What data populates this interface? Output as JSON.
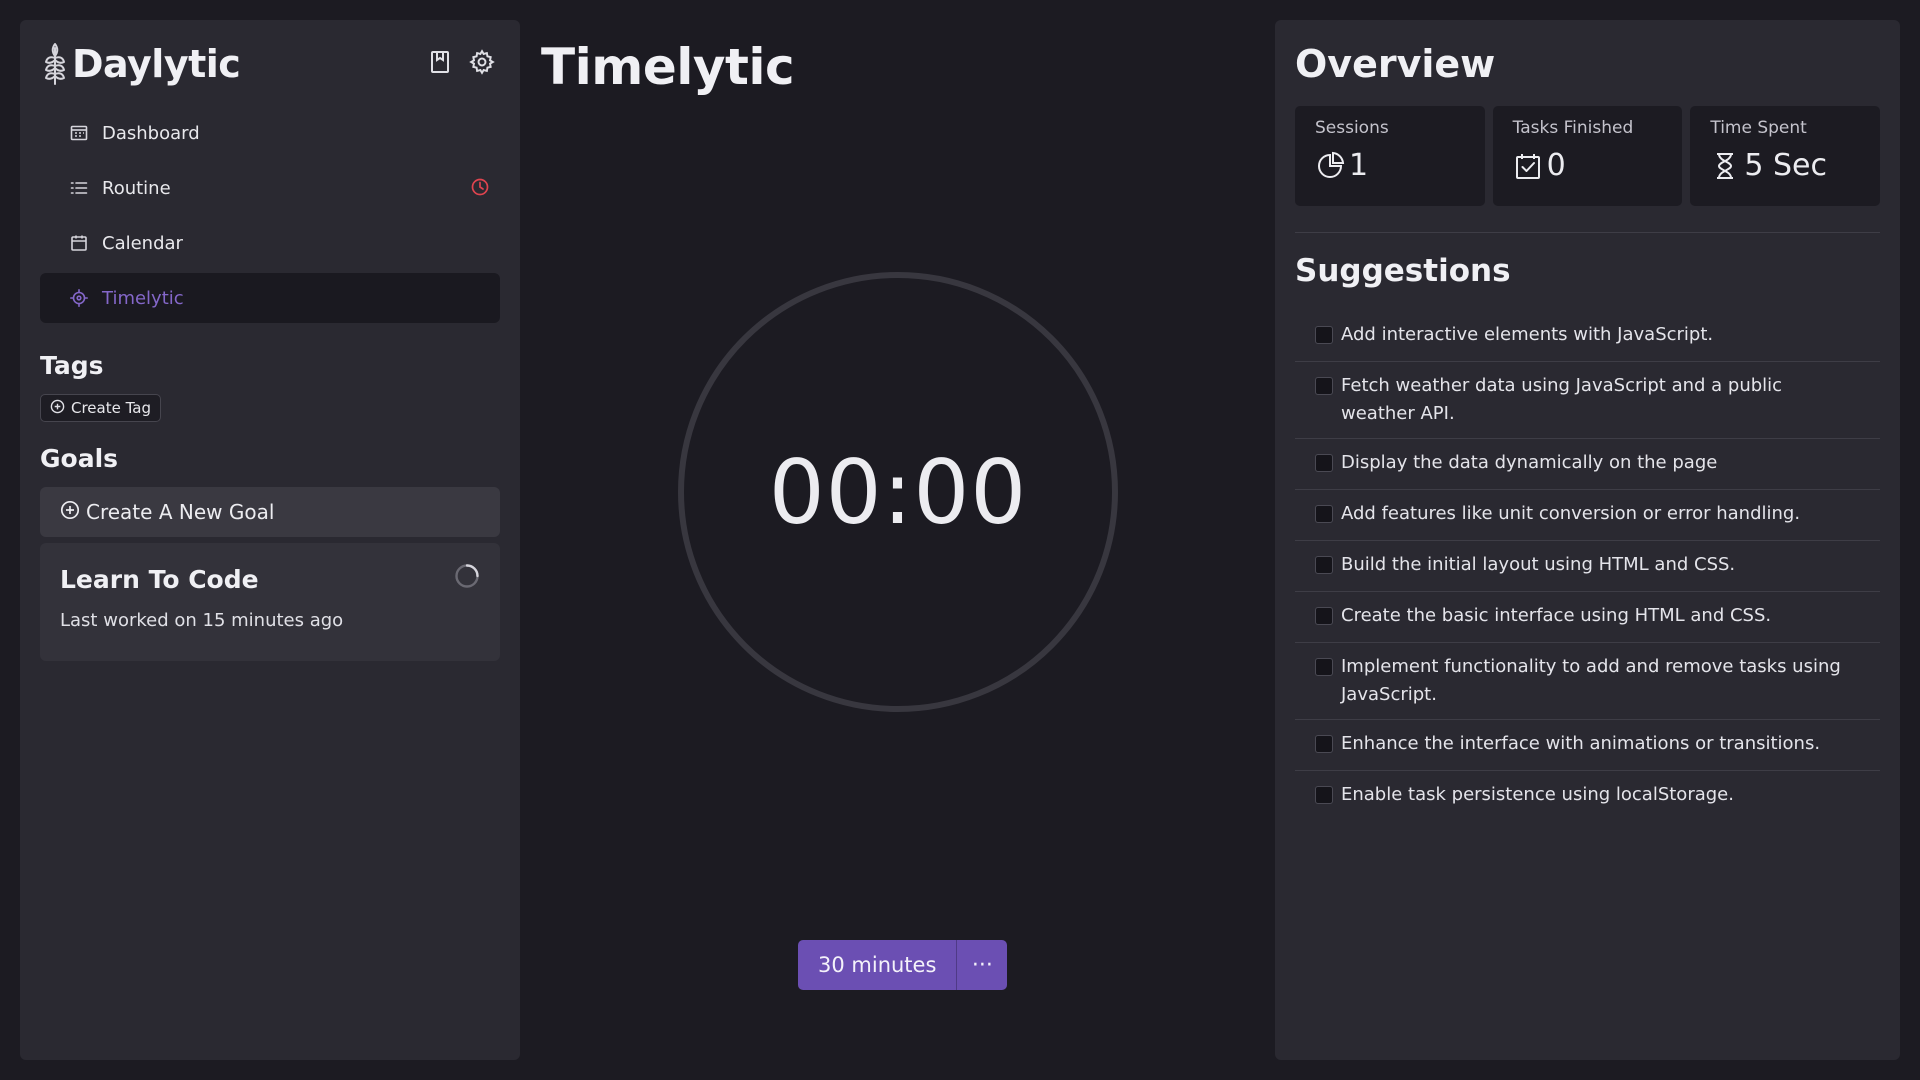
{
  "brand": {
    "name": "Daylytic",
    "logo_icon": "wheat-logo-icon"
  },
  "nav": [
    {
      "label": "Dashboard",
      "icon": "dashboard-icon",
      "active": false
    },
    {
      "label": "Routine",
      "icon": "list-icon",
      "active": false,
      "badge_icon": "clock-alert-icon",
      "badge_color": "#e0444f"
    },
    {
      "label": "Calendar",
      "icon": "calendar-icon",
      "active": false
    },
    {
      "label": "Timelytic",
      "icon": "crosshair-icon",
      "active": true
    }
  ],
  "tags": {
    "title": "Tags",
    "create_label": "Create Tag"
  },
  "goals": {
    "title": "Goals",
    "create_label": "Create A New Goal",
    "items": [
      {
        "name": "Learn To Code",
        "subtitle": "Last worked on 15 minutes ago"
      }
    ]
  },
  "center": {
    "title": "Timelytic",
    "timer": "00:00",
    "duration_label": "30 minutes",
    "more_label": "···"
  },
  "overview": {
    "title": "Overview",
    "stats": [
      {
        "label": "Sessions",
        "value": "1",
        "icon": "pie-chart-icon"
      },
      {
        "label": "Tasks Finished",
        "value": "0",
        "icon": "calendar-check-icon"
      },
      {
        "label": "Time Spent",
        "value": "5 Sec",
        "icon": "hourglass-icon"
      }
    ]
  },
  "suggestions": {
    "title": "Suggestions",
    "items": [
      "Add interactive elements with JavaScript.",
      "Fetch weather data using JavaScript and a public weather API.",
      "Display the data dynamically on the page",
      "Add features like unit conversion or error handling.",
      "Build the initial layout using HTML and CSS.",
      "Create the basic interface using HTML and CSS.",
      "Implement functionality to add and remove tasks using JavaScript.",
      "Enhance the interface with animations or transitions.",
      "Enable task persistence using localStorage."
    ]
  },
  "colors": {
    "accent": "#6b4fb3",
    "active_nav_text": "#8467c9",
    "alert": "#e0444f"
  }
}
